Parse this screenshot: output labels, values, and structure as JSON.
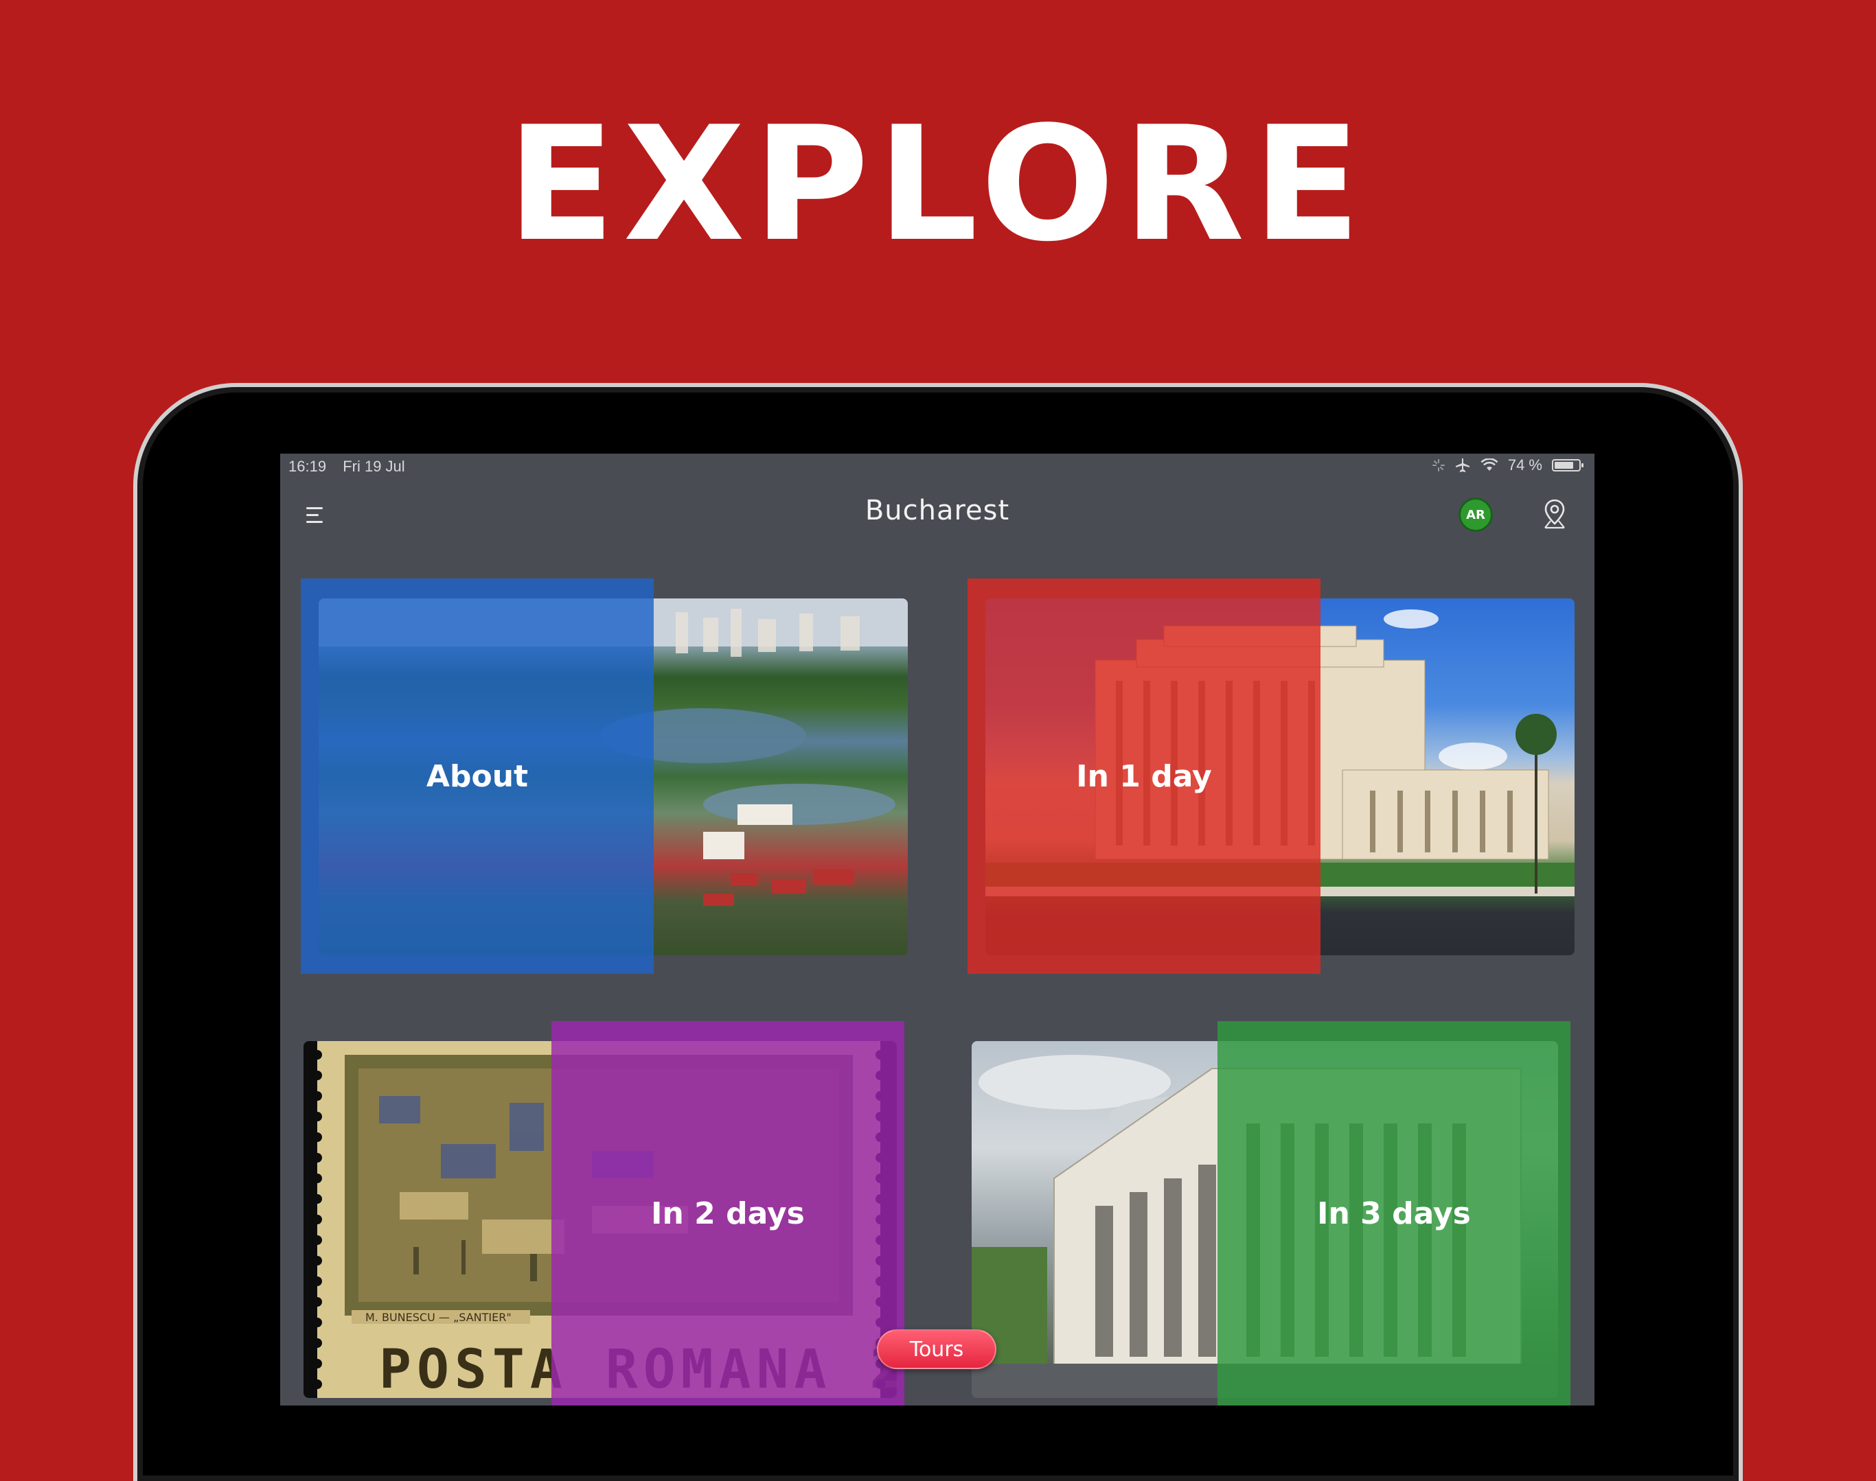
{
  "promo": {
    "headline": "EXPLORE"
  },
  "status_bar": {
    "time": "16:19",
    "date": "Fri 19 Jul",
    "battery_text": "74 %",
    "battery_level": 0.74
  },
  "nav": {
    "title": "Bucharest",
    "ar_label": "AR",
    "menu_icon": "menu-icon",
    "map_icon": "map-pin-icon"
  },
  "tiles": [
    {
      "label": "About",
      "color": "#1e64c8"
    },
    {
      "label": "In 1 day",
      "color": "#dc2a23"
    },
    {
      "label": "In 2 days",
      "color": "#9c27b0"
    },
    {
      "label": "In 3 days",
      "color": "#2e9a3e"
    }
  ],
  "tabs": {
    "tours_label": "Tours"
  }
}
